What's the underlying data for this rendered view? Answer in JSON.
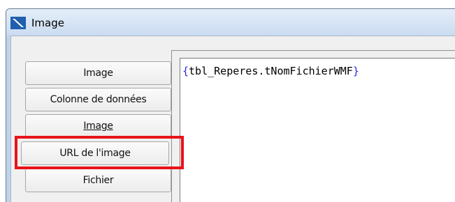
{
  "window": {
    "title": "Image",
    "icon": "image-app-icon"
  },
  "tabs": [
    {
      "label": "Image"
    },
    {
      "label": "Colonne de données"
    },
    {
      "label": "Image"
    },
    {
      "label": "URL de l'image",
      "selected": true
    },
    {
      "label": "Fichier"
    }
  ],
  "editor": {
    "open_brace": "{",
    "expression": "tbl_Reperes.tNomFichierWMF",
    "close_brace": "}"
  },
  "colors": {
    "highlight": "#e8121a",
    "brace": "#2a2ad8"
  }
}
